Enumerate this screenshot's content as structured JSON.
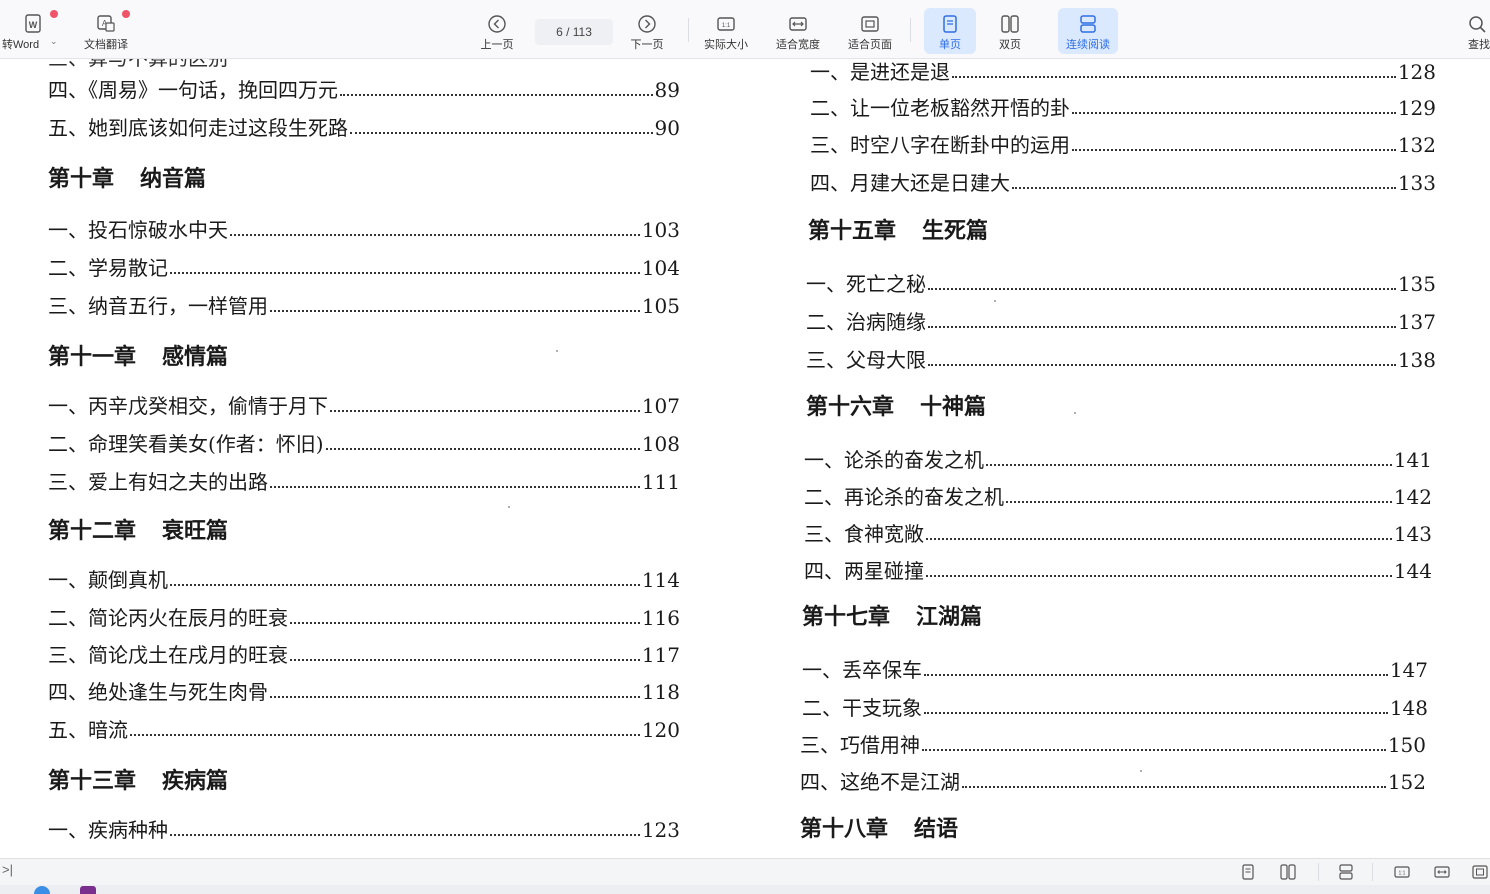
{
  "toolbar": {
    "to_word": "转Word",
    "translate": "文档翻译",
    "prev_page": "上一页",
    "page_current": "6",
    "page_total": "/ 113",
    "next_page": "下一页",
    "actual_size": "实际大小",
    "fit_width": "适合宽度",
    "fit_page": "适合页面",
    "single_page": "单页",
    "double_page": "双页",
    "continuous": "连续阅读",
    "search": "查找"
  },
  "left_column": {
    "partial_top": "三、算与不算的区别",
    "entries_a": [
      {
        "title": "四、《周易》一句话，挽回四万元",
        "page": "89"
      },
      {
        "title": "五、她到底该如何走过这段生死路",
        "page": "90"
      }
    ],
    "ch10": {
      "num": "第十章",
      "name": "纳音篇"
    },
    "entries_ch10": [
      {
        "title": "一、投石惊破水中天",
        "page": "103"
      },
      {
        "title": "二、学易散记",
        "page": "104"
      },
      {
        "title": "三、纳音五行，一样管用",
        "page": "105"
      }
    ],
    "ch11": {
      "num": "第十一章",
      "name": "感情篇"
    },
    "entries_ch11": [
      {
        "title": "一、丙辛戊癸相交，偷情于月下",
        "page": "107"
      },
      {
        "title": "二、命理笑看美女(作者：怀旧)",
        "page": "108"
      },
      {
        "title": "三、爱上有妇之夫的出路",
        "page": "111"
      }
    ],
    "ch12": {
      "num": "第十二章",
      "name": "衰旺篇"
    },
    "entries_ch12": [
      {
        "title": "一、颠倒真机",
        "page": "114"
      },
      {
        "title": "二、简论丙火在辰月的旺衰",
        "page": "116"
      },
      {
        "title": "三、简论戊土在戌月的旺衰",
        "page": "117"
      },
      {
        "title": "四、绝处逢生与死生肉骨",
        "page": "118"
      },
      {
        "title": "五、暗流",
        "page": "120"
      }
    ],
    "ch13": {
      "num": "第十三章",
      "name": "疾病篇"
    },
    "entries_ch13": [
      {
        "title": "一、疾病种种",
        "page": "123"
      }
    ]
  },
  "right_column": {
    "entries_a": [
      {
        "title": "一、是进还是退",
        "page": "128"
      },
      {
        "title": "二、让一位老板豁然开悟的卦",
        "page": "129"
      },
      {
        "title": "三、时空八字在断卦中的运用",
        "page": "132"
      },
      {
        "title": "四、月建大还是日建大",
        "page": "133"
      }
    ],
    "ch15": {
      "num": "第十五章",
      "name": "生死篇"
    },
    "entries_ch15": [
      {
        "title": "一、死亡之秘",
        "page": "135"
      },
      {
        "title": "二、治病随缘",
        "page": "137"
      },
      {
        "title": "三、父母大限",
        "page": "138"
      }
    ],
    "ch16": {
      "num": "第十六章",
      "name": "十神篇"
    },
    "entries_ch16": [
      {
        "title": "一、论杀的奋发之机",
        "page": "141"
      },
      {
        "title": "二、再论杀的奋发之机",
        "page": "142"
      },
      {
        "title": "三、食神宽敞",
        "page": "143"
      },
      {
        "title": "四、两星碰撞",
        "page": "144"
      }
    ],
    "ch17": {
      "num": "第十七章",
      "name": "江湖篇"
    },
    "entries_ch17": [
      {
        "title": "一、丢卒保车",
        "page": "147"
      },
      {
        "title": "二、干支玩象",
        "page": "148"
      },
      {
        "title": "三、巧借用神",
        "page": "150"
      },
      {
        "title": "四、这绝不是江湖",
        "page": "152"
      }
    ],
    "ch18": {
      "num": "第十八章",
      "name": "结语"
    }
  },
  "colors": {
    "accent": "#2f6fe4",
    "active_bg": "#dbe9ff",
    "badge": "#f05468"
  }
}
